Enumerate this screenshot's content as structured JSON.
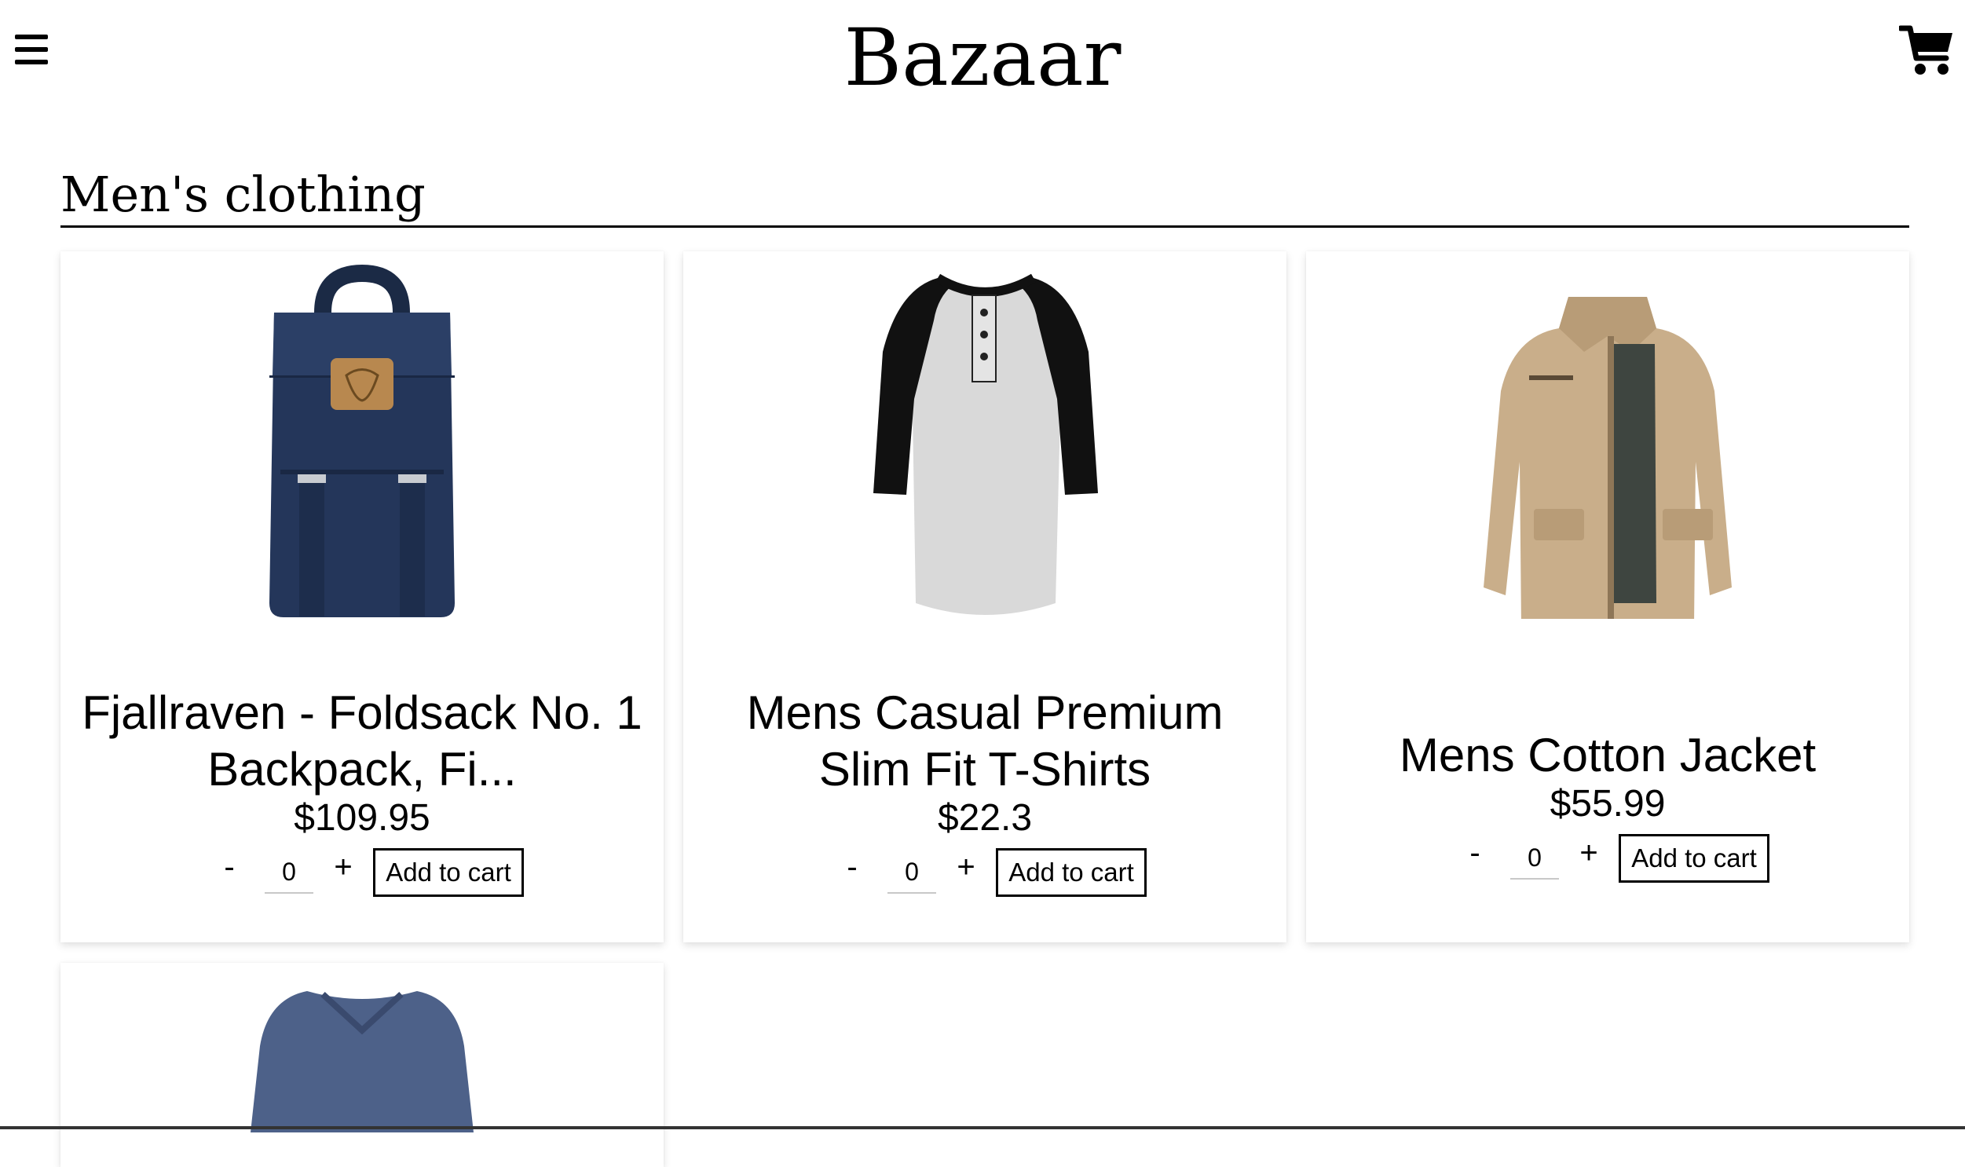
{
  "header": {
    "brand": "Bazaar",
    "menu_icon": "hamburger-menu-icon",
    "cart_icon": "shopping-cart-icon"
  },
  "section": {
    "title": "Men's clothing"
  },
  "products": [
    {
      "title": "Fjallraven - Foldsack No. 1 Backpack, Fi...",
      "price": "$109.95",
      "qty": "0",
      "minus": "-",
      "plus": "+",
      "add_label": "Add to cart",
      "image": "navy-backpack"
    },
    {
      "title": "Mens Casual Premium Slim Fit T-Shirts",
      "price": "$22.3",
      "qty": "0",
      "minus": "-",
      "plus": "+",
      "add_label": "Add to cart",
      "image": "raglan-henley-tshirt"
    },
    {
      "title": "Mens Cotton Jacket",
      "price": "$55.99",
      "qty": "0",
      "minus": "-",
      "plus": "+",
      "add_label": "Add to cart",
      "image": "khaki-cotton-jacket"
    },
    {
      "image": "blue-vneck-sweater"
    }
  ]
}
